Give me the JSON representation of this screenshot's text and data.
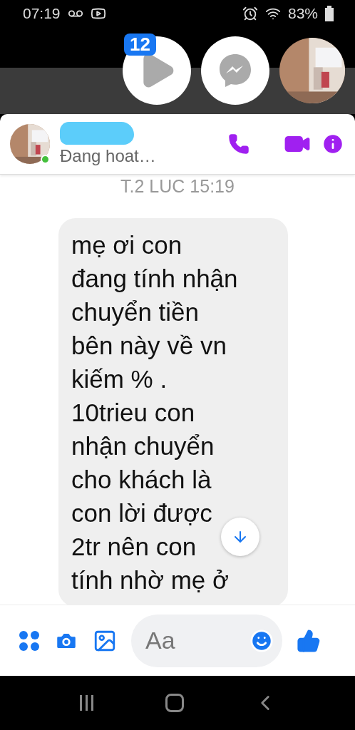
{
  "status_bar": {
    "time": "07:19",
    "battery": "83%"
  },
  "chat_heads": {
    "badge": "12"
  },
  "conversation": {
    "status": "Đang hoat…",
    "online": true,
    "timestamp": "T.2 LUC 15:19",
    "message": "mẹ ơi con\nđang tính nhận\nchuyển tiền\nbên này về vn\nkiếm % .\n10trieu con\nnhận chuyển\ncho khách là\ncon lời được\n2tr nên con\ntính nhờ mẹ ở"
  },
  "composer": {
    "placeholder": "Aa"
  }
}
